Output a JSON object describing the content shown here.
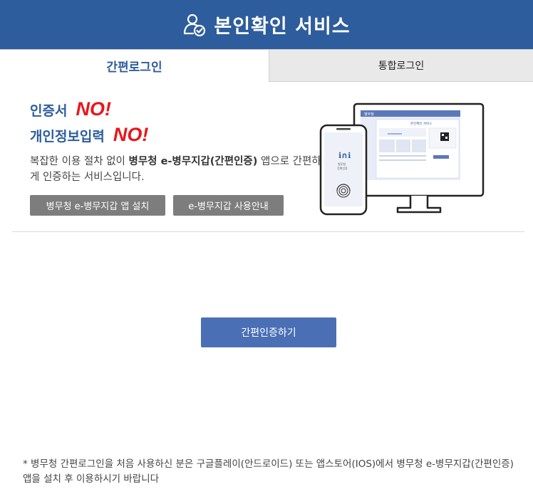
{
  "header": {
    "title": "본인확인 서비스",
    "icon": "user-check-icon"
  },
  "tabs": [
    {
      "label": "간편로그인",
      "active": true
    },
    {
      "label": "통합로그인",
      "active": false
    }
  ],
  "promo": {
    "line1_label": "인증서",
    "line1_no": "NO!",
    "line2_label": "개인정보입력",
    "line2_no": "NO!",
    "desc_prefix": "복잡한 이용 절차 없이 ",
    "desc_app_name": "병무청 e-병무지갑(간편인증)",
    "desc_suffix": " 앱으로 간편하게 인증하는 서비스입니다."
  },
  "buttons": {
    "install": "병무청 e-병무지갑 앱 설치",
    "guide": "e-병무지갑 사용안내",
    "authenticate": "간편인증하기"
  },
  "illustration": {
    "monitor_header": "병무청",
    "monitor_title": "본인확인 서비스",
    "phone_text_1": "병무청",
    "phone_text_2": "간편인증"
  },
  "notice": "* 병무청 간편로그인을 처음 사용하신 분은 구글플레이(안드로이드) 또는 앱스토어(IOS)에서 병무청 e-병무지갑(간편인증) 앱을 설치 후 이용하시기 바랍니다",
  "colors": {
    "brand": "#2d5d9c",
    "accent_red": "#e8161b",
    "primary_button": "#4a6fb5",
    "gray_button": "#7d7d7d"
  }
}
